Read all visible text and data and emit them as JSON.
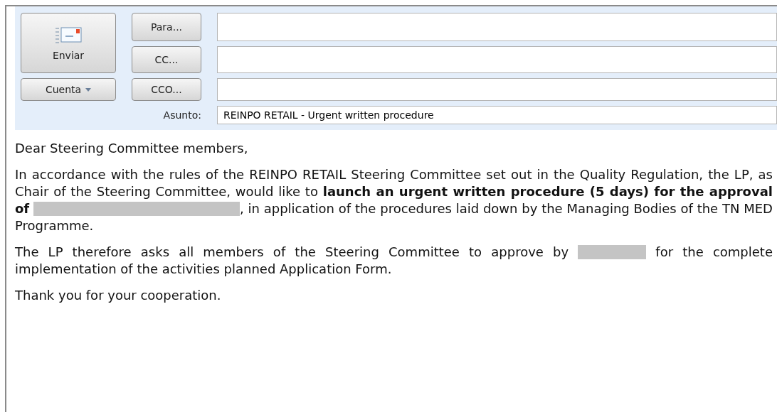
{
  "header": {
    "send_button": "Enviar",
    "account_button": "Cuenta",
    "recipients": [
      {
        "label": "Para..."
      },
      {
        "label": "CC..."
      },
      {
        "label": "CCO..."
      }
    ],
    "subject": {
      "label": "Asunto:",
      "value": "REINPO RETAIL - Urgent written procedure"
    }
  },
  "body": [
    [
      {
        "kind": "text",
        "text": "Dear Steering Committee members,"
      }
    ],
    [
      {
        "kind": "text",
        "text": "In accordance with the rules of the REINPO RETAIL Steering Committee set out in the Quality Regulation, the LP, as Chair of the Steering Committee, would like to **launch an urgent written procedure (5 days) for the approval of** "
      },
      {
        "kind": "long_redaction"
      },
      {
        "kind": "text",
        "text": ", in application of the procedures laid down by the Managing Bodies of the TN MED Programme."
      }
    ],
    [
      {
        "kind": "text",
        "text": "The LP therefore asks all members of the Steering Committee to approve by "
      },
      {
        "kind": "short_redaction"
      },
      {
        "kind": "text",
        "text": " for the complete implementation of the activities planned Application Form."
      }
    ],
    [
      {
        "kind": "text",
        "text": "Thank you for your cooperation."
      }
    ]
  ]
}
